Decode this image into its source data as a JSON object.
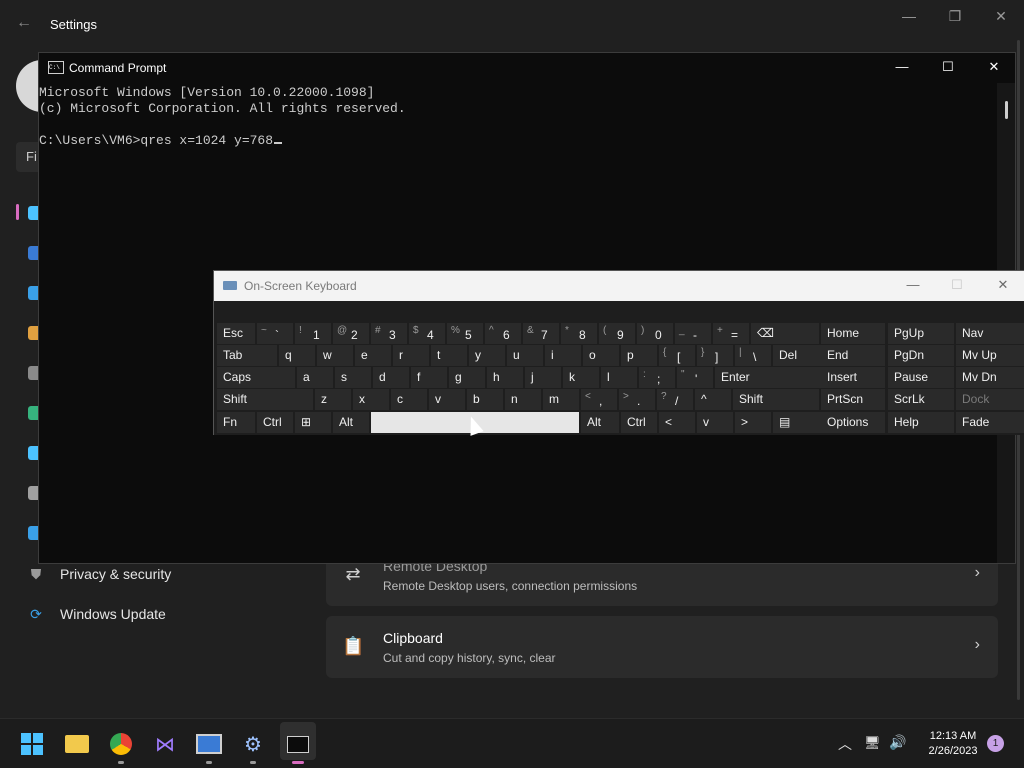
{
  "settings": {
    "title": "Settings",
    "find_placeholder": "Fi",
    "nav": [
      {
        "label": "Privacy & security",
        "icon": "shield-icon"
      },
      {
        "label": "Windows Update",
        "icon": "windows-update-icon"
      }
    ],
    "cards": [
      {
        "title": "Remote Desktop",
        "subtitle": "Remote Desktop users, connection permissions",
        "icon": "remote-desktop-icon"
      },
      {
        "title": "Clipboard",
        "subtitle": "Cut and copy history, sync, clear",
        "icon": "clipboard-icon"
      }
    ]
  },
  "cmd": {
    "title": "Command Prompt",
    "lines": [
      "Microsoft Windows [Version 10.0.22000.1098]",
      "(c) Microsoft Corporation. All rights reserved.",
      "",
      "C:\\Users\\VM6>qres x=1024 y=768"
    ]
  },
  "osk": {
    "title": "On-Screen Keyboard",
    "rows": [
      [
        "Esc",
        "~ `",
        "! 1",
        "@ 2",
        "# 3",
        "$ 4",
        "% 5",
        "^ 6",
        "& 7",
        "* 8",
        "( 9",
        ") 0",
        "_ -",
        "+ =",
        "⌫"
      ],
      [
        "Tab",
        "q",
        "w",
        "e",
        "r",
        "t",
        "y",
        "u",
        "i",
        "o",
        "p",
        "{ [",
        "} ]",
        "| \\",
        "Del"
      ],
      [
        "Caps",
        "a",
        "s",
        "d",
        "f",
        "g",
        "h",
        "j",
        "k",
        "l",
        ": ;",
        "\" '",
        "Enter"
      ],
      [
        "Shift",
        "z",
        "x",
        "c",
        "v",
        "b",
        "n",
        "m",
        "< ,",
        "> .",
        "? /",
        "^",
        "Shift"
      ],
      [
        "Fn",
        "Ctrl",
        "⊞",
        "Alt",
        "",
        "Alt",
        "Ctrl",
        "<",
        "v",
        ">",
        "▤"
      ]
    ],
    "nav_keys": [
      [
        "Home",
        "PgUp",
        "Nav"
      ],
      [
        "End",
        "PgDn",
        "Mv Up"
      ],
      [
        "Insert",
        "Pause",
        "Mv Dn"
      ],
      [
        "PrtScn",
        "ScrLk",
        "Dock"
      ],
      [
        "Options",
        "Help",
        "Fade"
      ]
    ]
  },
  "taskbar": {
    "time": "12:13 AM",
    "date": "2/26/2023",
    "notifications": "1",
    "apps": [
      "start-icon",
      "file-explorer-icon",
      "chrome-icon",
      "visual-studio-icon",
      "remote-desktop-app-icon",
      "settings-app-icon",
      "command-prompt-app-icon"
    ]
  }
}
